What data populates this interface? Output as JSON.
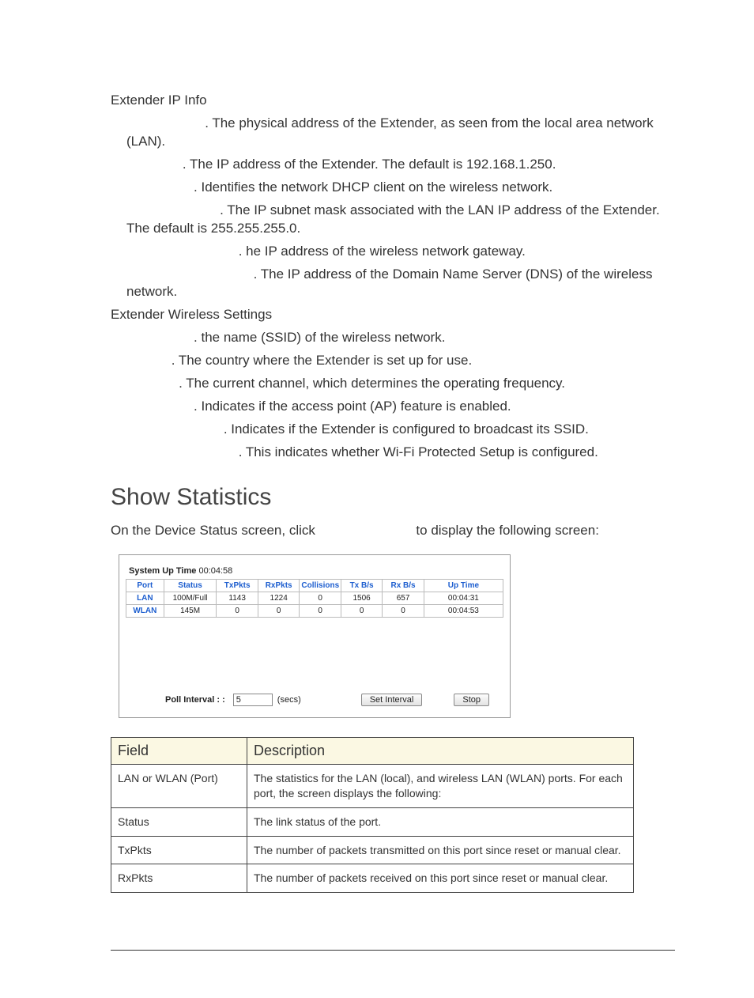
{
  "ip_info": {
    "heading": "Extender IP Info",
    "lines": [
      ". The physical address of the Extender, as seen from the local area network (LAN).",
      ". The IP address of the Extender. The default is 192.168.1.250.",
      ". Identifies the network DHCP client on the wireless network.",
      ". The IP subnet mask associated with the LAN IP address of the Extender. The default is 255.255.255.0.",
      ". he IP address of the wireless network gateway.",
      ". The IP address of the Domain Name Server (DNS) of the wireless network."
    ]
  },
  "wireless": {
    "heading": "Extender Wireless Settings",
    "lines": [
      ". the name (SSID) of the wireless network.",
      ". The country where the Extender is set up for use.",
      ". The current channel, which determines the operating frequency.",
      ". Indicates if the access point (AP) feature is enabled.",
      ". Indicates if the Extender is configured to broadcast its SSID.",
      ". This indicates whether Wi-Fi Protected Setup is configured."
    ]
  },
  "stats_section": {
    "title": "Show Statistics",
    "intro_before": "On the Device Status screen, click ",
    "intro_after": " to display the following screen:"
  },
  "chart_data": {
    "type": "table",
    "title": "System Up Time",
    "system_up_time": "00:04:58",
    "columns": [
      "Port",
      "Status",
      "TxPkts",
      "RxPkts",
      "Collisions",
      "Tx B/s",
      "Rx B/s",
      "Up Time"
    ],
    "rows": [
      [
        "LAN",
        "100M/Full",
        "1143",
        "1224",
        "0",
        "1506",
        "657",
        "00:04:31"
      ],
      [
        "WLAN",
        "145M",
        "0",
        "0",
        "0",
        "0",
        "0",
        "00:04:53"
      ]
    ],
    "controls": {
      "poll_label": "Poll Interval : :",
      "poll_value": "5",
      "poll_unit": "(secs)",
      "set_btn": "Set Interval",
      "stop_btn": "Stop"
    }
  },
  "field_table": {
    "headers": [
      "Field",
      "Description"
    ],
    "rows": [
      [
        "LAN or WLAN (Port)",
        "The statistics for the LAN (local), and wireless LAN (WLAN) ports. For each port, the screen displays the following:"
      ],
      [
        "Status",
        "The link status of the port."
      ],
      [
        "TxPkts",
        "The number of packets transmitted on this port since reset or manual clear."
      ],
      [
        "RxPkts",
        "The number of packets received on this port since reset or manual clear."
      ]
    ]
  }
}
